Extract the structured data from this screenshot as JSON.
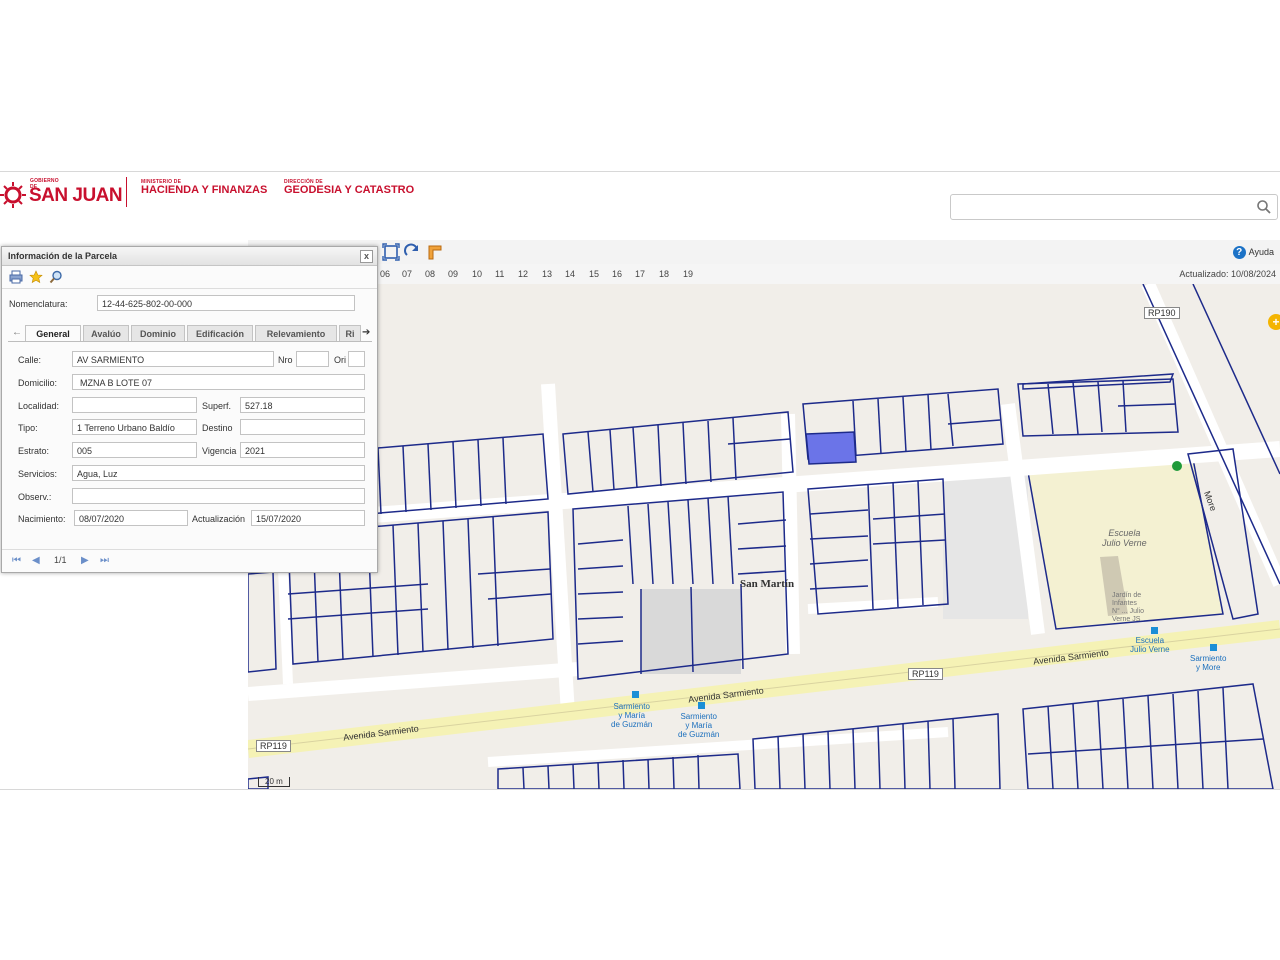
{
  "header": {
    "gov_small": "GOBIERNO DE",
    "gov_big": "SAN JUAN",
    "ministry_small": "MINISTERIO DE",
    "ministry_big": "HACIENDA Y FINANZAS",
    "direction_small": "DIRECCIÓN DE",
    "direction_big": "GEODESIA Y CATASTRO",
    "search_value": "",
    "brand_color": "#c8102e"
  },
  "toolbar": {
    "help_label": "Ayuda",
    "ticks": [
      "06",
      "07",
      "08",
      "09",
      "10",
      "11",
      "12",
      "13",
      "14",
      "15",
      "16",
      "17",
      "18",
      "19"
    ],
    "updated": "Actualizado: 10/08/2024"
  },
  "dialog": {
    "title": "Información de la Parcela",
    "close": "x",
    "nomenclatura_label": "Nomenclatura:",
    "nomenclatura_value": "12-44-625-802-00-000",
    "tabs": [
      "General",
      "Avalúo",
      "Dominio",
      "Edificación",
      "Relevamiento",
      "Ri"
    ],
    "fields": {
      "calle_label": "Calle:",
      "calle": "AV SARMIENTO",
      "nro_label": "Nro",
      "nro": "",
      "ori_label": "Ori",
      "ori": "",
      "domicilio_label": "Domicilio:",
      "domicilio": "MZNA B LOTE 07",
      "localidad_label": "Localidad:",
      "localidad": "",
      "superf_label": "Superf.",
      "superf": "527.18",
      "tipo_label": "Tipo:",
      "tipo": "1 Terreno Urbano Baldío",
      "destino_label": "Destino",
      "destino": "",
      "estrato_label": "Estrato:",
      "estrato": "005",
      "vigencia_label": "Vigencia",
      "vigencia": "2021",
      "servicios_label": "Servicios:",
      "servicios": "Agua, Luz",
      "observ_label": "Observ.:",
      "observ": "",
      "nacimiento_label": "Nacimiento:",
      "nacimiento": "08/07/2020",
      "actualizacion_label": "Actualización",
      "actualizacion": "15/07/2020"
    },
    "pager": "1/1"
  },
  "map": {
    "school": "Escuela\nJulio Verne",
    "jardin": "Jardín de\nInfantes\nN° ... Julio\nVerne JS",
    "district": "San Martín",
    "street_1": "Avenida Sarmiento",
    "street_2": "Avenida Sarmiento",
    "street_3": "Avenida Sarmiento",
    "street_more": "More",
    "route_1": "RP190",
    "route_2": "RP119",
    "route_3": "RP119",
    "poi_1": "Sarmiento\ny María\nde Guzmán",
    "poi_2": "Sarmiento\ny María\nde Guzmán",
    "poi_3": "Escuela\nJulio Verne",
    "poi_4": "Sarmiento\ny More",
    "scale": "20 m",
    "parcel_color": "#1d2a8a",
    "selected_color": "#6b74e8"
  }
}
